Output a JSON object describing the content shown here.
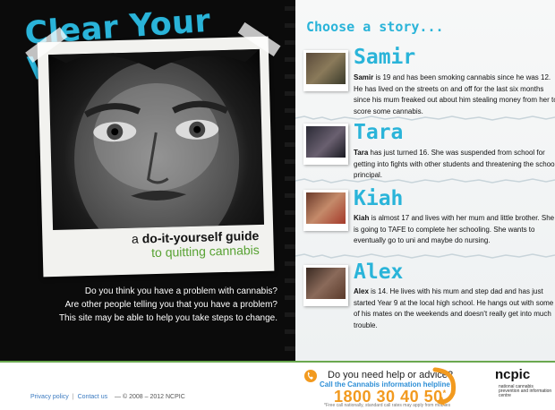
{
  "hero": {
    "title": "Clear Your Vision",
    "guide_line1_pre": "a ",
    "guide_line1_bold": "do-it-yourself guide",
    "guide_line2": "to quitting cannabis",
    "intro_lines": [
      "Do you think you have a problem with cannabis?",
      "Are other people telling you that you have a problem?",
      "This site may be able to help you take steps to change."
    ]
  },
  "stories_heading": "Choose a story...",
  "stories": [
    {
      "name": "Samir",
      "bold": "Samir",
      "text": " is 19 and has been smoking cannabis since he was 12. He has lived on the streets on and off for the last six months since his mum freaked out about him stealing money from her to score some cannabis."
    },
    {
      "name": "Tara",
      "bold": "Tara",
      "text": " has just turned 16. She was suspended from school for getting into fights with other students and threatening the school principal."
    },
    {
      "name": "Kiah",
      "bold": "Kiah",
      "text": " is almost 17 and lives with her mum and little brother. She is going to TAFE to complete her schooling. She wants to eventually go to uni and maybe do nursing."
    },
    {
      "name": "Alex",
      "bold": "Alex",
      "text": " is 14. He lives with his mum and step dad and has just started Year 9 at the local high school. He hangs out with some of his mates on the weekends and doesn't really get into much trouble."
    }
  ],
  "footer": {
    "privacy": "Privacy policy",
    "contact": "Contact us",
    "copyright": "— © 2008 – 2012 NCPIC",
    "help_question": "Do you need help or advice?",
    "help_line": "Call the Cannabis information helpline",
    "phone": "1800 30 40 50",
    "phone_mark": "*",
    "note": "*Free call nationally, standard call rates may apply from mobiles",
    "logo": "ncpic",
    "logo_sub": "national cannabis prevention and information centre"
  },
  "colors": {
    "accent": "#2ab4d9",
    "green": "#58a233",
    "orange": "#f29a1f",
    "link": "#3a7ac0"
  }
}
